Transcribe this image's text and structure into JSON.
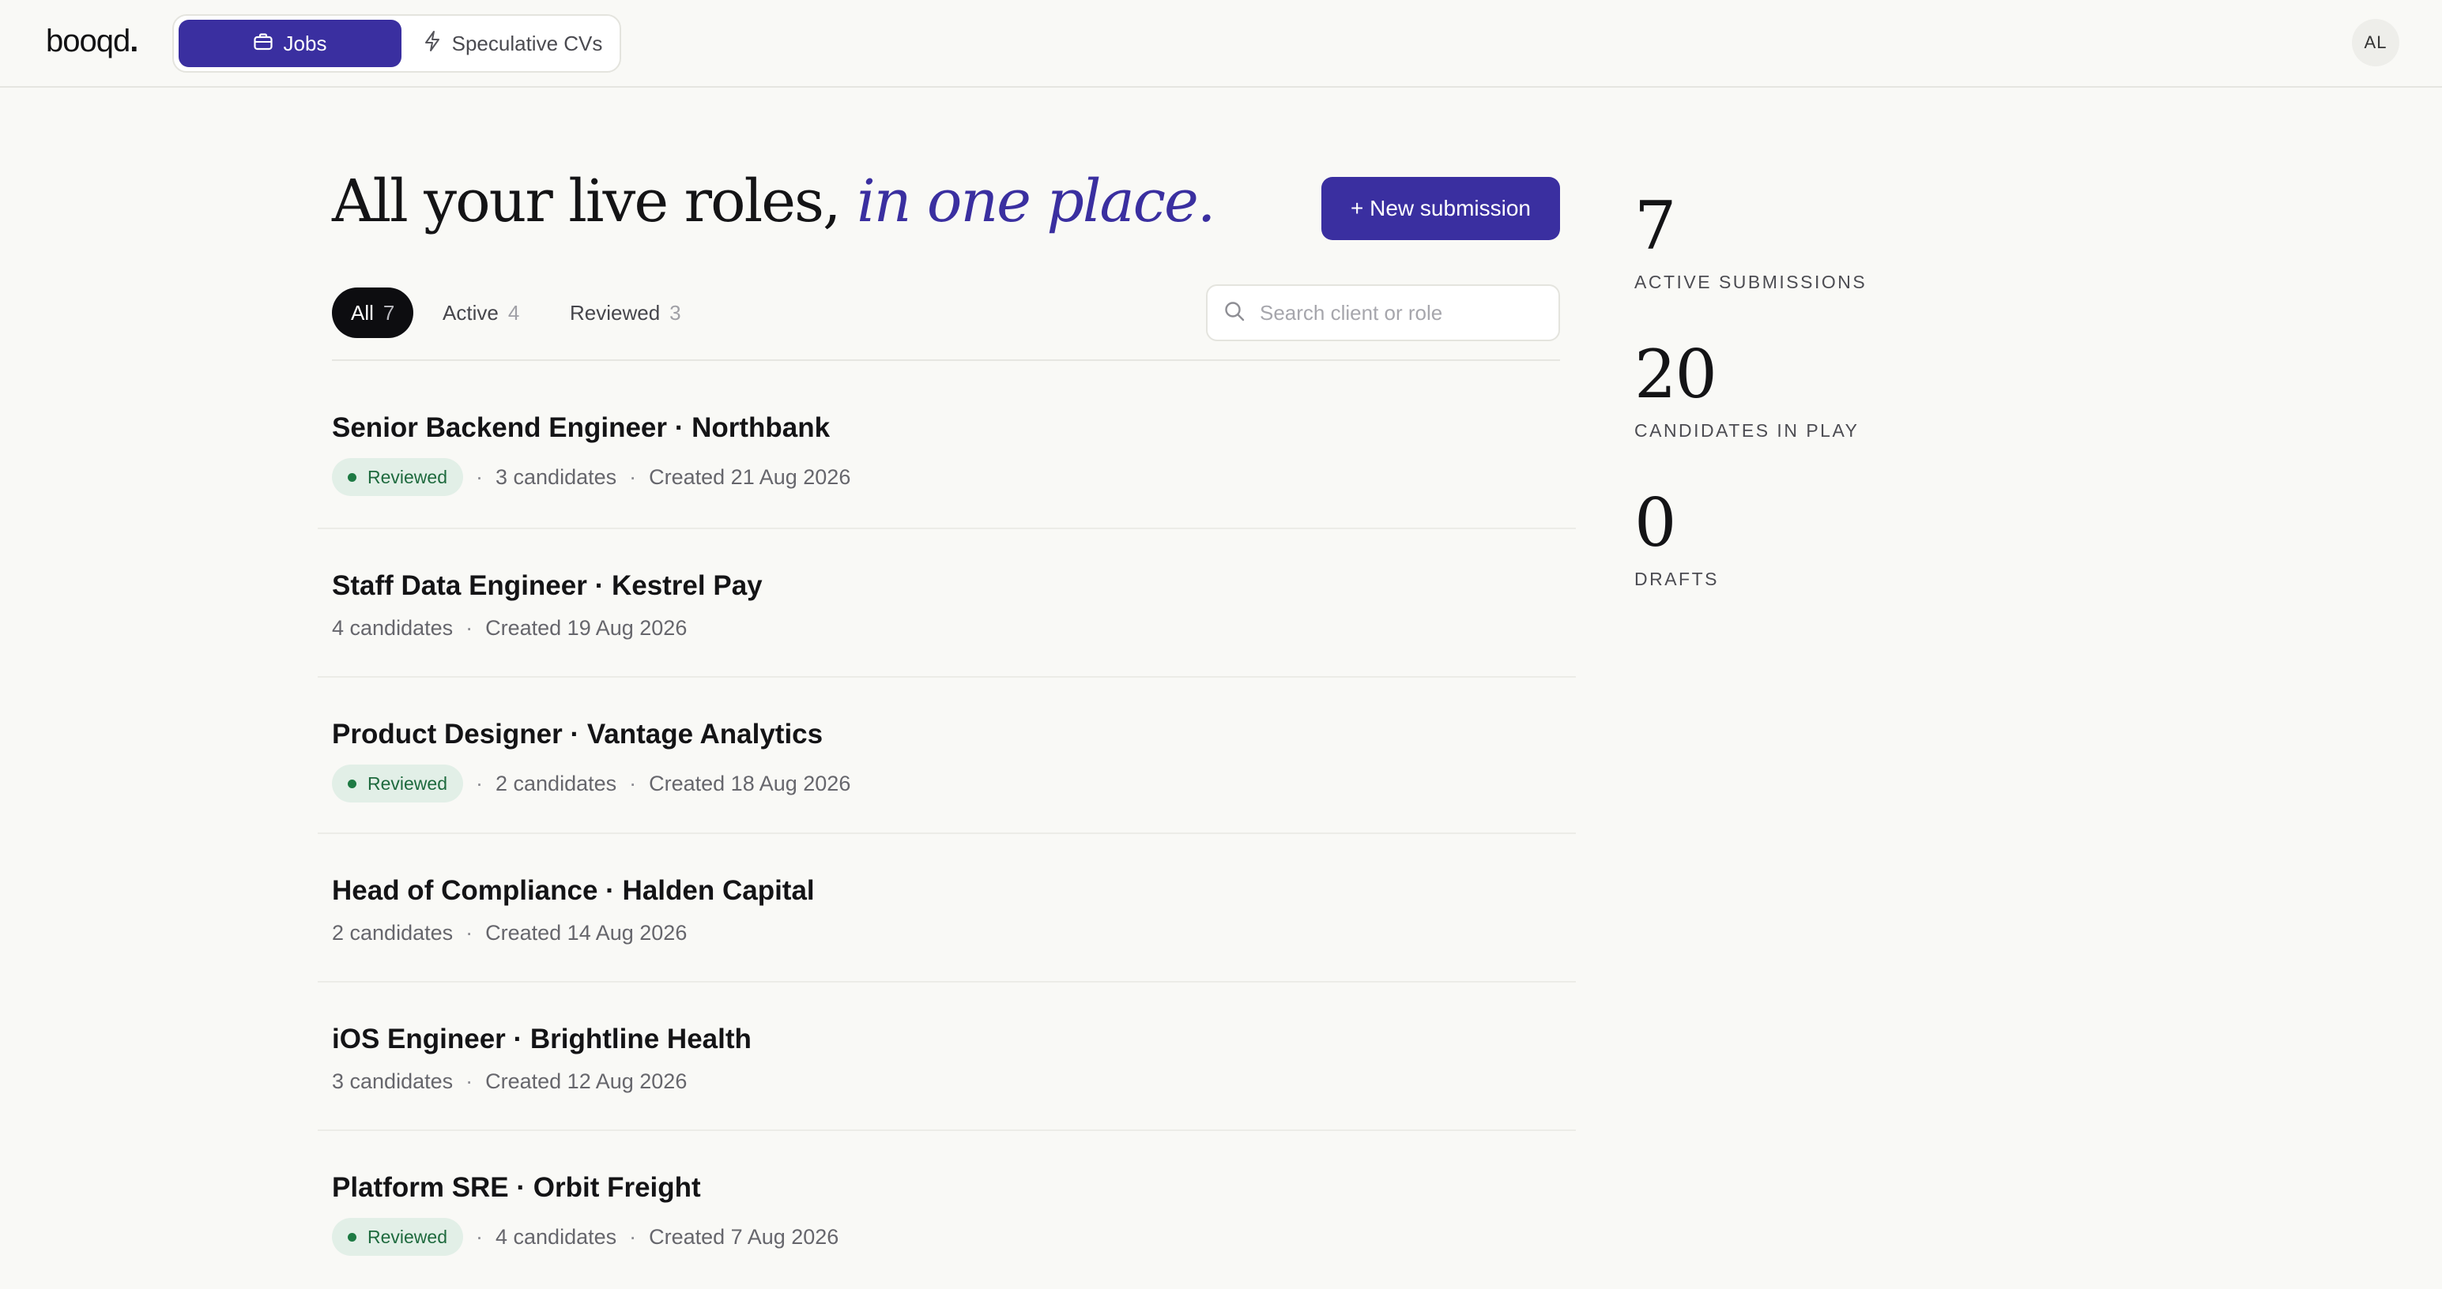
{
  "app": {
    "logo": "booqd",
    "logo_dot": "."
  },
  "nav": {
    "jobs_label": "Jobs",
    "speculative_label": "Speculative CVs",
    "avatar_initials": "AL"
  },
  "header": {
    "title_main": "All your live roles, ",
    "title_accent": "in one place.",
    "new_button": "+ New submission"
  },
  "filters": [
    {
      "label": "All",
      "count": "7"
    },
    {
      "label": "Active",
      "count": "4"
    },
    {
      "label": "Reviewed",
      "count": "3"
    }
  ],
  "search": {
    "placeholder": "Search client or role"
  },
  "roles": [
    {
      "title": "Senior Backend Engineer · Northbank",
      "status": "Reviewed",
      "candidates": "3 candidates",
      "created": "Created 21 Aug 2026"
    },
    {
      "title": "Staff Data Engineer · Kestrel Pay",
      "status": "",
      "candidates": "4 candidates",
      "created": "Created 19 Aug 2026"
    },
    {
      "title": "Product Designer · Vantage Analytics",
      "status": "Reviewed",
      "candidates": "2 candidates",
      "created": "Created 18 Aug 2026"
    },
    {
      "title": "Head of Compliance · Halden Capital",
      "status": "",
      "candidates": "2 candidates",
      "created": "Created 14 Aug 2026"
    },
    {
      "title": "iOS Engineer · Brightline Health",
      "status": "",
      "candidates": "3 candidates",
      "created": "Created 12 Aug 2026"
    },
    {
      "title": "Platform SRE · Orbit Freight",
      "status": "Reviewed",
      "candidates": "4 candidates",
      "created": "Created 7 Aug 2026"
    }
  ],
  "stats": [
    {
      "value": "7",
      "label": "ACTIVE SUBMISSIONS"
    },
    {
      "value": "20",
      "label": "CANDIDATES IN PLAY"
    },
    {
      "value": "0",
      "label": "DRAFTS"
    }
  ],
  "colors": {
    "accent": "#3a2fa0",
    "background": "#f9f9f6",
    "badge_bg": "#e2efe7",
    "badge_text": "#1e6a3e"
  }
}
